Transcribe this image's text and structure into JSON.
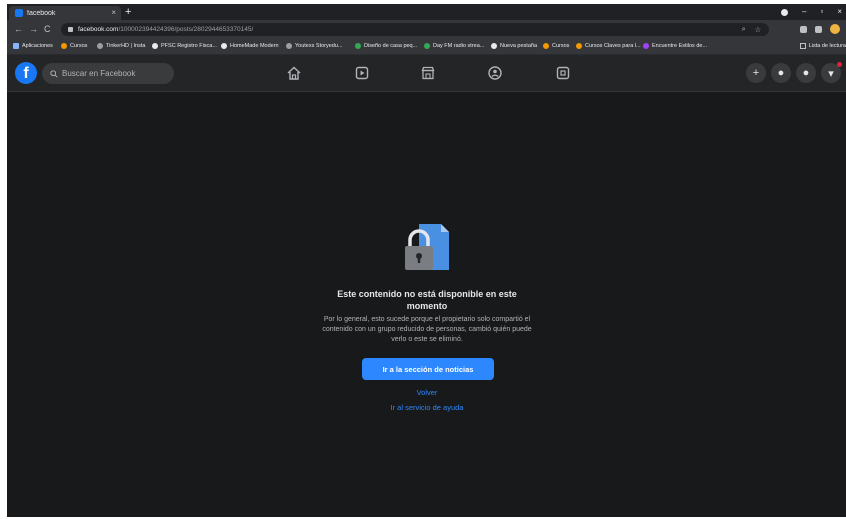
{
  "browser": {
    "tab_title": "facebook",
    "tab_close": "×",
    "new_tab": "+",
    "window_controls": {
      "minimize": "–",
      "maximize": "▫",
      "close": "×"
    },
    "nav": {
      "back": "←",
      "forward": "→",
      "reload": "C"
    },
    "url_host": "facebook.com",
    "url_path": "/100002394424396/posts/2802944653370145/",
    "omnibox_icons": {
      "zoom": "⌕",
      "star": "☆"
    }
  },
  "bookmarks": {
    "items": [
      {
        "label": "Aplicaciones",
        "color": "#8ab4f8"
      },
      {
        "label": "Cursos",
        "color": "#f29900"
      },
      {
        "label": "TinkerHD | Insta",
        "color": "#9aa0a6"
      },
      {
        "label": "PFSC Registro Fisca...",
        "color": "#e8eaed"
      },
      {
        "label": "HomeMade Modern",
        "color": "#e8eaed"
      },
      {
        "label": "Youtexs Storyedu...",
        "color": "#9aa0a6"
      },
      {
        "label": "Diseño de casa peq...",
        "color": "#34a853"
      },
      {
        "label": "Day FM radio strea...",
        "color": "#34a853"
      },
      {
        "label": "Nueva pestaña",
        "color": "#e8eaed"
      },
      {
        "label": "Cursos",
        "color": "#f29900"
      },
      {
        "label": "Cursos Claves para l...",
        "color": "#f29900"
      },
      {
        "label": "Encuentre Estilos de...",
        "color": "#a142f4"
      }
    ],
    "reading_list": "Lista de lectura"
  },
  "facebook": {
    "logo": "f",
    "search_placeholder": "Buscar en Facebook",
    "nav_icons": [
      "home-icon",
      "watch-icon",
      "marketplace-icon",
      "groups-icon",
      "gaming-icon"
    ],
    "right_icons": {
      "create": "+",
      "messenger": "●",
      "notifications": "●",
      "account": "▾"
    },
    "accent_color": "#2d88ff"
  },
  "content": {
    "title": "Este contenido no está disponible en este momento",
    "body": "Por lo general, esto sucede porque el propietario solo compartió el contenido con un grupo reducido de personas, cambió quién puede verlo o este se eliminó.",
    "primary_button": "Ir a la sección de noticias",
    "back_link": "Volver",
    "help_link": "Ir al servicio de ayuda"
  }
}
